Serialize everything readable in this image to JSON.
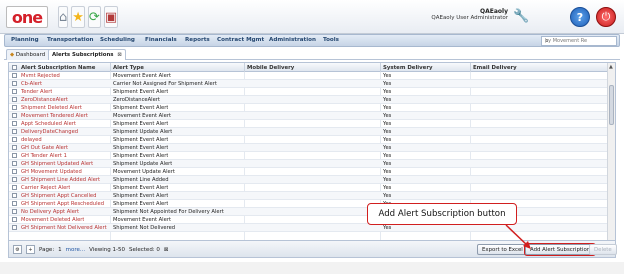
{
  "header": {
    "logo_text": "one",
    "user_name": "QAEaoly",
    "user_role": "QAEaoly User Administrator",
    "icons": [
      "home-icon",
      "star-icon",
      "refresh-icon",
      "report-icon",
      "wrench-icon",
      "help-icon",
      "power-icon"
    ]
  },
  "nav": {
    "items": [
      "Planning",
      "Transportation",
      "Scheduling",
      "Financials",
      "Reports",
      "Contract Mgmt",
      "Administration",
      "Tools"
    ],
    "search_placeholder": "by Movement Re"
  },
  "tabs": [
    {
      "label": "Dashboard",
      "active": false
    },
    {
      "label": "Alerts Subscriptions",
      "active": true
    }
  ],
  "grid": {
    "columns": [
      "Alert Subscription Name",
      "Alert Type",
      "Mobile Delivery",
      "System Delivery",
      "Email Delivery"
    ],
    "rows": [
      {
        "name": "Mvmt Rejected",
        "type": "Movement Event Alert",
        "mobile": "",
        "system": "Yes",
        "email": ""
      },
      {
        "name": "Cb-Alert",
        "type": "Carrier Not Assigned For Shipment Alert",
        "mobile": "",
        "system": "Yes",
        "email": ""
      },
      {
        "name": "Tender Alert",
        "type": "Shipment Event Alert",
        "mobile": "",
        "system": "Yes",
        "email": ""
      },
      {
        "name": "ZeroDistanceAlert",
        "type": "ZeroDistanceAlert",
        "mobile": "",
        "system": "Yes",
        "email": ""
      },
      {
        "name": "Shipment Deleted Alert",
        "type": "Shipment Event Alert",
        "mobile": "",
        "system": "Yes",
        "email": ""
      },
      {
        "name": "Movement Tendered Alert",
        "type": "Movement Event Alert",
        "mobile": "",
        "system": "Yes",
        "email": ""
      },
      {
        "name": "Appt Scheduled Alert",
        "type": "Shipment Event Alert",
        "mobile": "",
        "system": "Yes",
        "email": ""
      },
      {
        "name": "DeliveryDateChanged",
        "type": "Shipment Update Alert",
        "mobile": "",
        "system": "Yes",
        "email": ""
      },
      {
        "name": "delayed",
        "type": "Shipment Event Alert",
        "mobile": "",
        "system": "Yes",
        "email": ""
      },
      {
        "name": "GH Out Gate Alert",
        "type": "Shipment Event Alert",
        "mobile": "",
        "system": "Yes",
        "email": ""
      },
      {
        "name": "GH Tender Alert 1",
        "type": "Shipment Event Alert",
        "mobile": "",
        "system": "Yes",
        "email": ""
      },
      {
        "name": "GH Shipment Updated Alert",
        "type": "Shipment Update Alert",
        "mobile": "",
        "system": "Yes",
        "email": ""
      },
      {
        "name": "GH Movement Updated",
        "type": "Movement Update Alert",
        "mobile": "",
        "system": "Yes",
        "email": ""
      },
      {
        "name": "GH Shipment Line Added Alert",
        "type": "Shipment Line Added",
        "mobile": "",
        "system": "Yes",
        "email": ""
      },
      {
        "name": "Carrier Reject Alert",
        "type": "Shipment Event Alert",
        "mobile": "",
        "system": "Yes",
        "email": ""
      },
      {
        "name": "GH Shipment Appt Cancelled",
        "type": "Shipment Event Alert",
        "mobile": "",
        "system": "Yes",
        "email": ""
      },
      {
        "name": "GH Shipment Appt Rescheduled",
        "type": "Shipment Event Alert",
        "mobile": "",
        "system": "Yes",
        "email": ""
      },
      {
        "name": "No Delivery Appt Alert",
        "type": "Shipment Not Appointed For Delivery Alert",
        "mobile": "",
        "system": "Yes",
        "email": ""
      },
      {
        "name": "Movement Deleted Alert",
        "type": "Movement Event Alert",
        "mobile": "",
        "system": "Yes",
        "email": ""
      },
      {
        "name": "GH Shipment Not Delivered Alert",
        "type": "Shipment Not Delivered",
        "mobile": "",
        "system": "Yes",
        "email": ""
      }
    ]
  },
  "footer": {
    "page_label": "Page:",
    "page_number": "1",
    "more_label": "more...",
    "viewing": "Viewing 1-50",
    "selected": "Selected: 0",
    "export_button": "Export to Excel",
    "add_button": "Add Alert Subscription",
    "delete_button": "Delete"
  },
  "annotation": {
    "text": "Add Alert Subscription button",
    "color": "#d11f1f"
  }
}
